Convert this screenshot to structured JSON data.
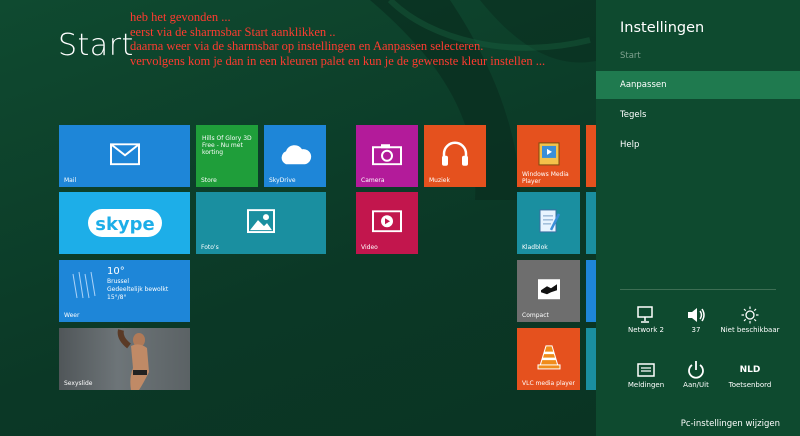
{
  "start": {
    "title": "Start"
  },
  "annotation": {
    "lines": [
      "heb het gevonden ...",
      "eerst via de sharmsbar  Start aanklikken ..",
      "daarna weer via de sharmsbar  op instellingen en Aanpassen selecteren.",
      "vervolgens  kom je dan in een kleuren palet  en kun je de gewenste kleur instellen ..."
    ],
    "color": "#ff3b30"
  },
  "tiles": {
    "mail": "Mail",
    "store": {
      "label": "Store",
      "promo": [
        "Hills Of Glory 3D",
        "Free - Nu met",
        "korting"
      ]
    },
    "skydrive": "SkyDrive",
    "camera": "Camera",
    "muziek": "Muziek",
    "windows_media_player": [
      "Windows Media",
      "Player"
    ],
    "skype": {
      "logo": "skype"
    },
    "foto": "Foto's",
    "video": "Video",
    "kladblok": "Kladblok",
    "weer": {
      "label": "Weer",
      "temp": "10°",
      "city": "Brussel",
      "cond": "Gedeeltelijk bewolkt",
      "range": "15°/8°"
    },
    "compact": "Compact",
    "sexyslide": "Sexyslide",
    "vlc": "VLC media player"
  },
  "tile_colors": {
    "blue": "#1e86d8",
    "green": "#1f9e3a",
    "magenta": "#b31b9a",
    "orange": "#e5511e",
    "cyan": "#1daee8",
    "teal": "#1a8fa0",
    "crimson": "#c2164d",
    "gray": "#6e6e6e"
  },
  "charms": {
    "title": "Instellingen",
    "items": [
      {
        "label": "Start",
        "state": "dim"
      },
      {
        "label": "Aanpassen",
        "state": "selected"
      },
      {
        "label": "Tegels",
        "state": "normal"
      },
      {
        "label": "Help",
        "state": "normal"
      }
    ],
    "quick": [
      {
        "icon": "network-icon",
        "label": "Network  2"
      },
      {
        "icon": "volume-icon",
        "label": "37"
      },
      {
        "icon": "brightness-icon",
        "label": "Niet beschikbaar"
      },
      {
        "icon": "notifications-icon",
        "label": "Meldingen"
      },
      {
        "icon": "power-icon",
        "label": "Aan/Uit"
      },
      {
        "icon": "keyboard-icon",
        "label": "Toetsenbord",
        "badge": "NLD"
      }
    ],
    "pc_settings": "Pc-instellingen wijzigen",
    "accent": "#1f7a4f"
  }
}
